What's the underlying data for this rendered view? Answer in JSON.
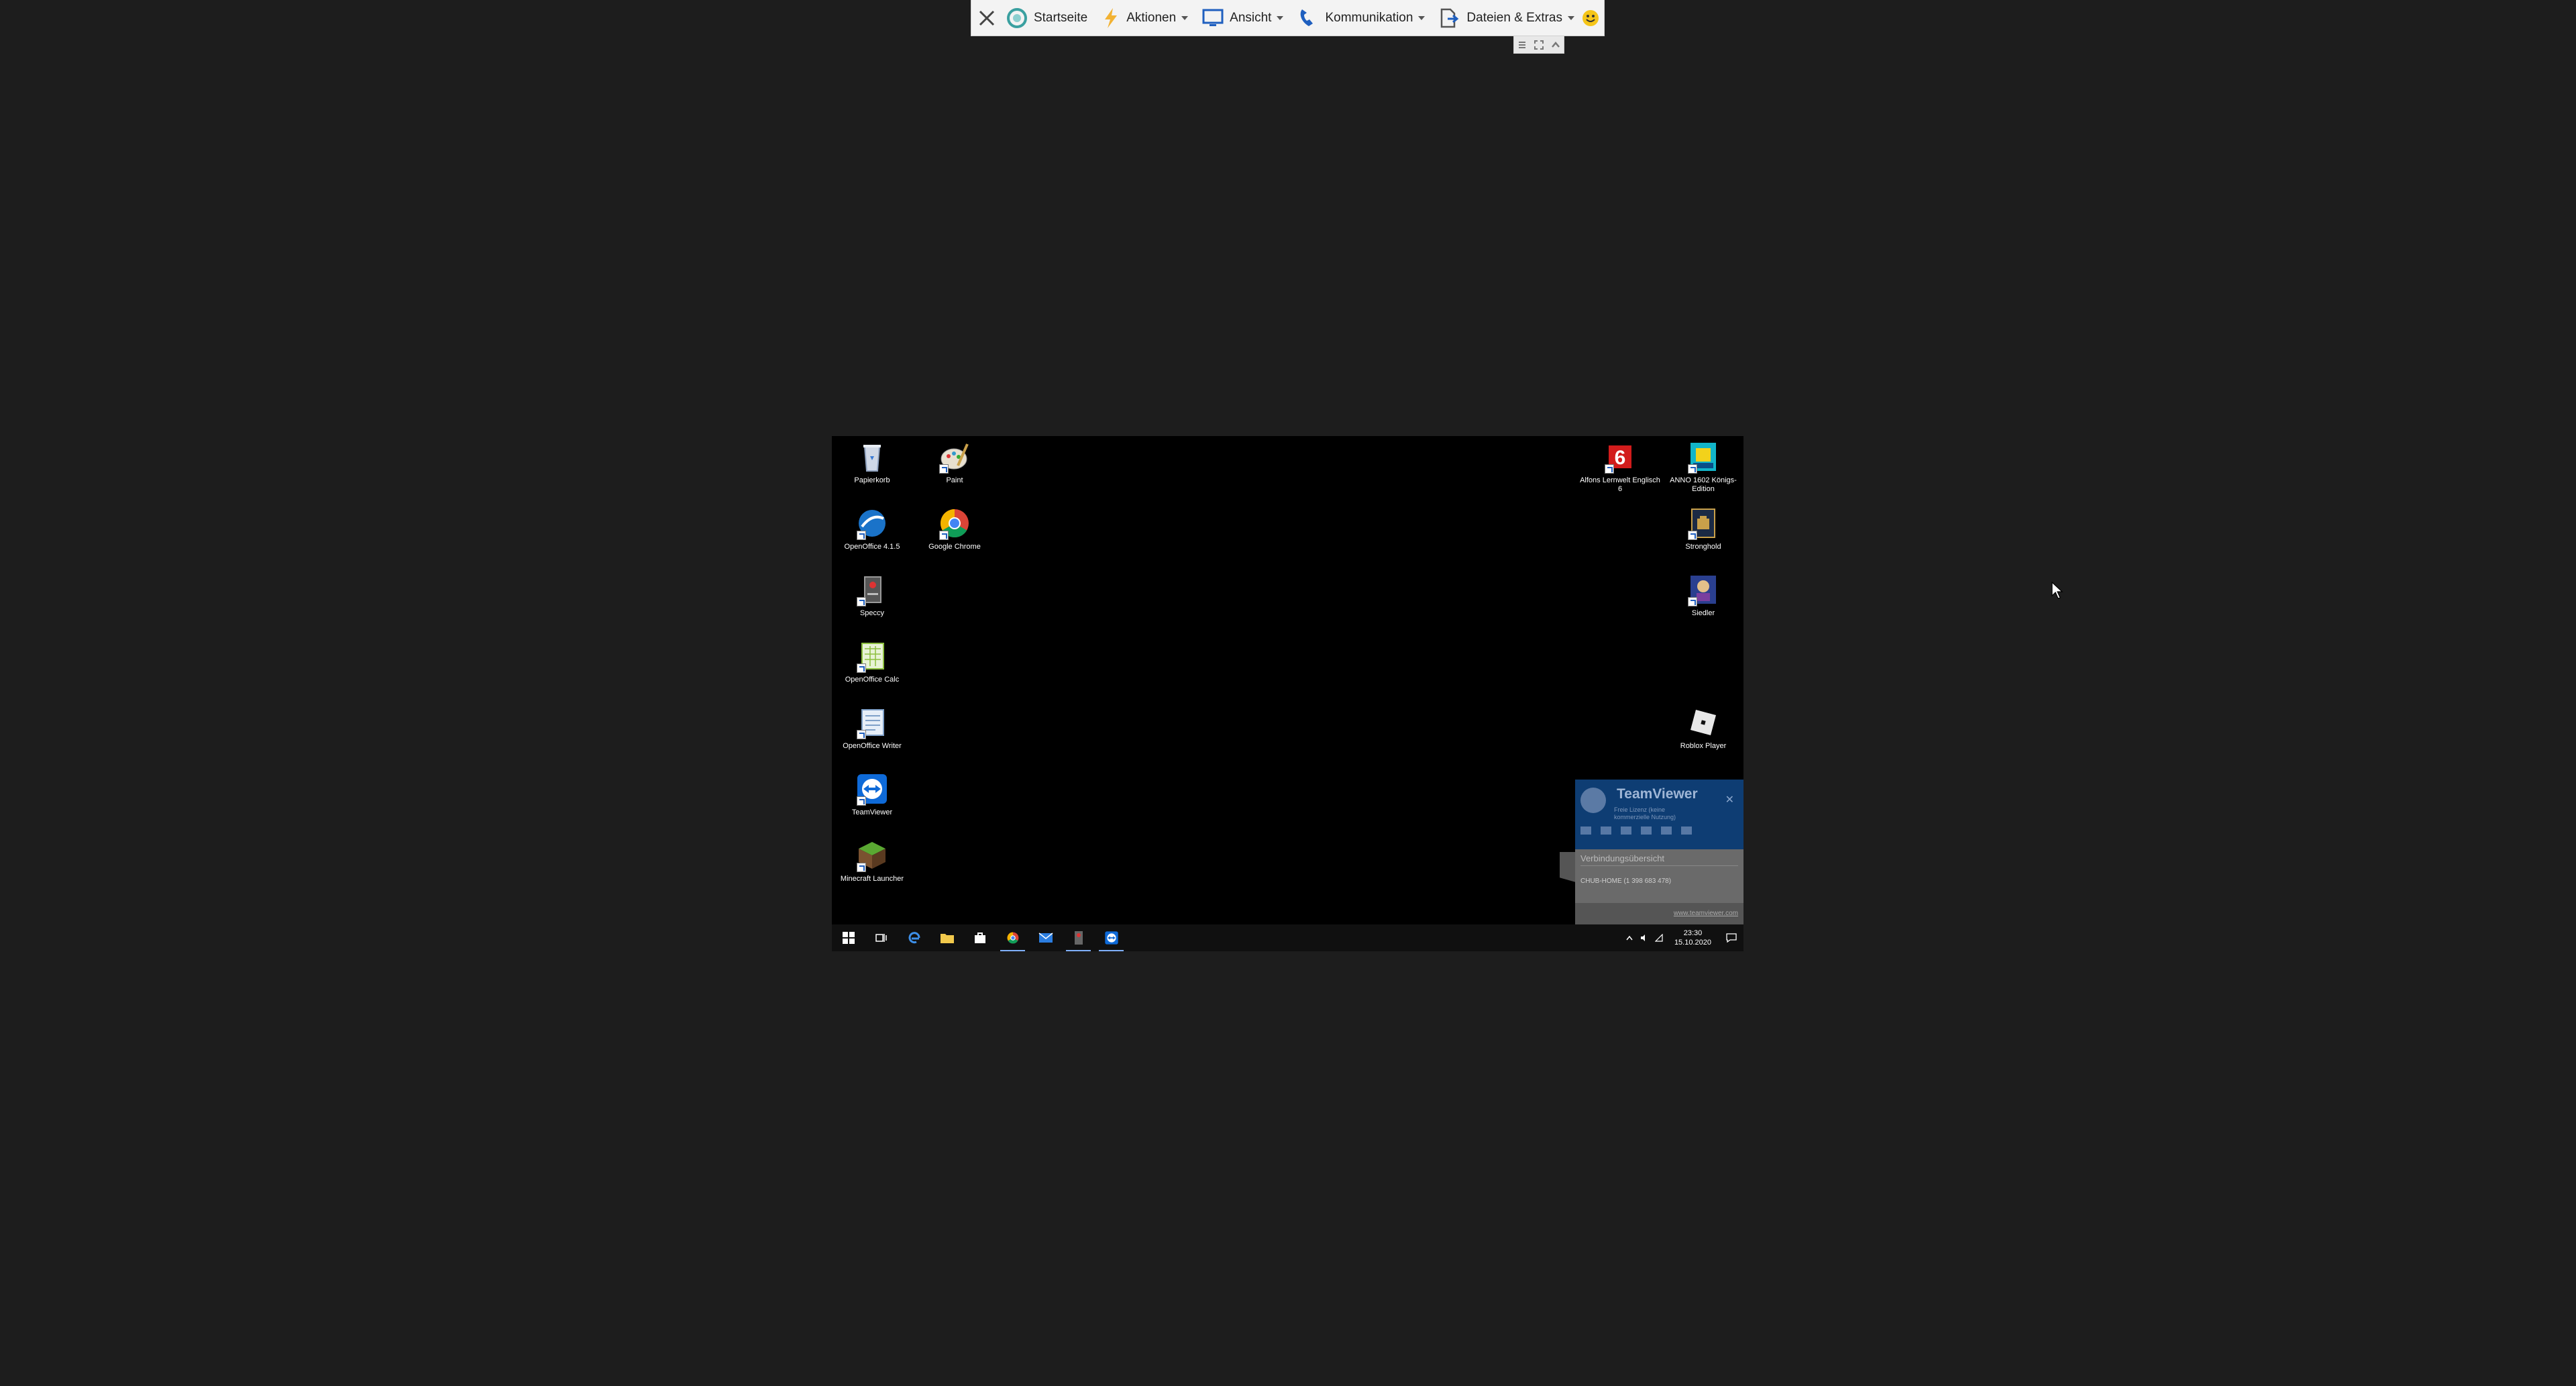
{
  "toolbar": {
    "items": [
      {
        "label": "Startseite"
      },
      {
        "label": "Aktionen"
      },
      {
        "label": "Ansicht"
      },
      {
        "label": "Kommunikation"
      },
      {
        "label": "Dateien & Extras"
      }
    ]
  },
  "desktop": {
    "icons_left_col1": [
      {
        "label": "Papierkorb",
        "icon": "recycle-bin-icon"
      },
      {
        "label": "OpenOffice 4.1.5",
        "icon": "openoffice-icon"
      },
      {
        "label": "Speccy",
        "icon": "speccy-icon"
      },
      {
        "label": "OpenOffice Calc",
        "icon": "calc-icon"
      },
      {
        "label": "OpenOffice Writer",
        "icon": "writer-icon"
      },
      {
        "label": "TeamViewer",
        "icon": "teamviewer-icon"
      },
      {
        "label": "Minecraft Launcher",
        "icon": "minecraft-icon"
      }
    ],
    "icons_left_col2": [
      {
        "label": "Paint",
        "icon": "paint-icon"
      },
      {
        "label": "Google Chrome",
        "icon": "chrome-icon"
      }
    ],
    "icons_right_col1": [
      {
        "label": "Alfons Lernwelt Englisch 6",
        "icon": "alfons-icon"
      }
    ],
    "icons_right_col2": [
      {
        "label": "ANNO 1602 Königs-Edition",
        "icon": "anno-icon"
      },
      {
        "label": "Stronghold",
        "icon": "stronghold-icon"
      },
      {
        "label": "Siedler",
        "icon": "siedler-icon"
      },
      {
        "label": "Roblox Player",
        "icon": "roblox-icon"
      }
    ]
  },
  "teamviewer_panel": {
    "brand": "TeamViewer",
    "subtitle_1": "Freie Lizenz (keine",
    "subtitle_2": "kommerzielle Nutzung)",
    "section": "Verbindungsübersicht",
    "connection": "CHUB-HOME (1 398 683 478)",
    "footer_link": "www.teamviewer.com"
  },
  "taskbar": {
    "time": "23:30",
    "date": "15.10.2020"
  },
  "colors": {
    "remote_bg": "#000000",
    "outer_bg": "#1d1d1d",
    "toolbar_bg": "#f3f3f3",
    "teamviewer_blue": "#0e3d73"
  }
}
